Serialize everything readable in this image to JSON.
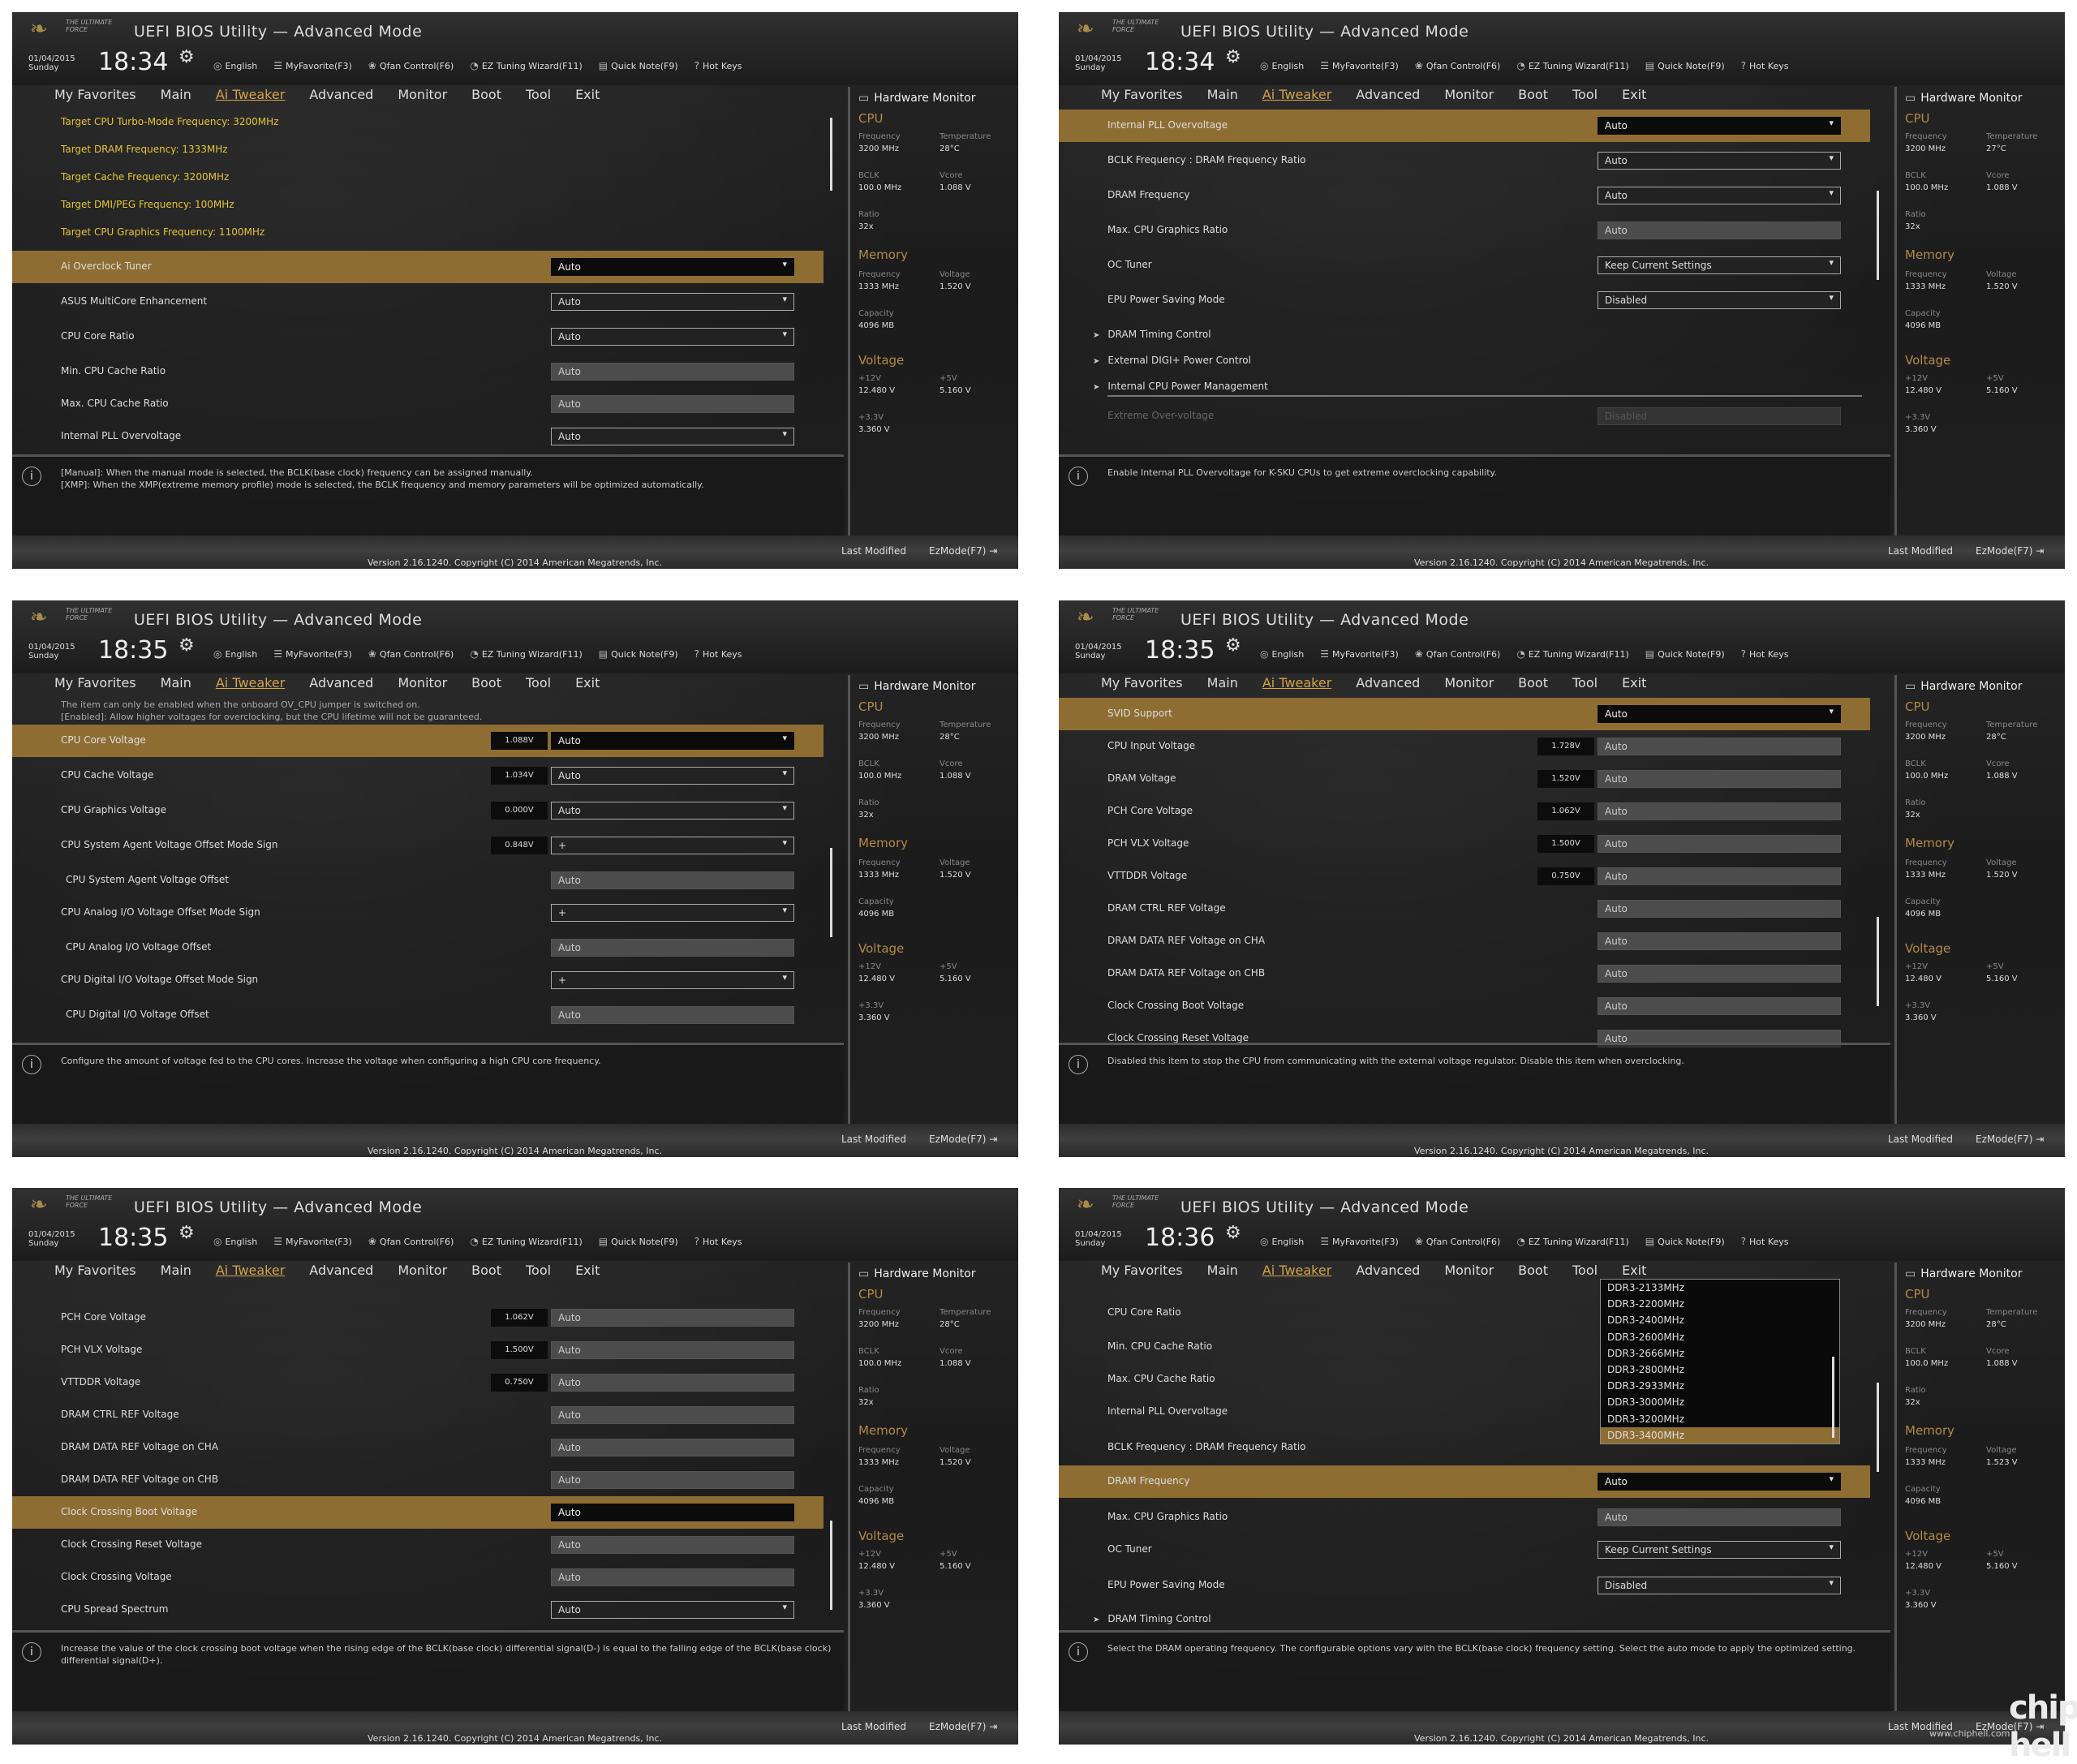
{
  "common": {
    "app_title": "UEFI BIOS Utility — Advanced Mode",
    "logo_text": "THE ULTIMATE FORCE",
    "date": "01/04/2015",
    "day": "Sunday",
    "menu": {
      "english": "English",
      "myfavorite": "MyFavorite(F3)",
      "qfan": "Qfan Control(F6)",
      "eztuning": "EZ Tuning Wizard(F11)",
      "quicknote": "Quick Note(F9)",
      "hotkeys": "Hot Keys"
    },
    "tabs": [
      "My Favorites",
      "Main",
      "Ai Tweaker",
      "Advanced",
      "Monitor",
      "Boot",
      "Tool",
      "Exit"
    ],
    "active_tab": "Ai Tweaker",
    "version": "Version 2.16.1240. Copyright (C) 2014 American Megatrends, Inc.",
    "last_modified": "Last Modified",
    "ezmode": "EzMode(F7)",
    "hw": {
      "title": "Hardware Monitor",
      "cpu": "CPU",
      "frequency_lbl": "Frequency",
      "temperature_lbl": "Temperature",
      "bclk_lbl": "BCLK",
      "vcore_lbl": "Vcore",
      "ratio_lbl": "Ratio",
      "memory": "Memory",
      "voltage_lbl": "Voltage",
      "capacity_lbl": "Capacity",
      "voltage": "Voltage",
      "v12_lbl": "+12V",
      "v5_lbl": "+5V",
      "v33_lbl": "+3.3V",
      "cpu_freq": "3200 MHz",
      "bclk": "100.0 MHz",
      "vcore": "1.088 V",
      "ratio": "32x",
      "mem_freq": "1333 MHz",
      "mem_cap": "4096 MB",
      "v12": "12.480 V",
      "v5": "5.160 V",
      "v33": "3.360 V"
    }
  },
  "panels": [
    {
      "time": "18:34",
      "temp": "28°C",
      "mem_volt": "1.520 V",
      "rows": [
        {
          "label": "Target CPU Turbo-Mode Frequency: 3200MHz",
          "kind": "target"
        },
        {
          "label": "Target DRAM Frequency: 1333MHz",
          "kind": "target"
        },
        {
          "label": "Target Cache Frequency: 3200MHz",
          "kind": "target"
        },
        {
          "label": "Target DMI/PEG Frequency: 100MHz",
          "kind": "target"
        },
        {
          "label": "Target CPU Graphics Frequency: 1100MHz",
          "kind": "target"
        },
        {
          "label": "Ai Overclock Tuner",
          "value": "Auto",
          "dropdown": true,
          "selected": true
        },
        {
          "label": "ASUS MultiCore Enhancement",
          "value": "Auto",
          "dropdown": true
        },
        {
          "label": "CPU Core Ratio",
          "value": "Auto",
          "dropdown": true
        },
        {
          "label": "Min. CPU Cache Ratio",
          "value": "Auto",
          "flat": true
        },
        {
          "label": "Max. CPU Cache Ratio",
          "value": "Auto",
          "flat": true
        },
        {
          "label": "Internal PLL Overvoltage",
          "value": "Auto",
          "dropdown": true
        }
      ],
      "help": [
        "[Manual]: When the manual mode is selected, the BCLK(base clock) frequency can be assigned manually.",
        "[XMP]: When the XMP(extreme memory profile) mode is selected, the BCLK frequency and memory parameters will be optimized automatically."
      ]
    },
    {
      "time": "18:34",
      "temp": "27°C",
      "mem_volt": "1.520 V",
      "rows": [
        {
          "label": "Internal PLL Overvoltage",
          "value": "Auto",
          "dropdown": true,
          "selected": true
        },
        {
          "label": "BCLK Frequency : DRAM Frequency Ratio",
          "value": "Auto",
          "dropdown": true
        },
        {
          "label": "DRAM Frequency",
          "value": "Auto",
          "dropdown": true
        },
        {
          "label": "Max. CPU Graphics Ratio",
          "value": "Auto",
          "flat": true
        },
        {
          "label": "OC Tuner",
          "value": "Keep Current Settings",
          "dropdown": true
        },
        {
          "label": "EPU Power Saving Mode",
          "value": "Disabled",
          "dropdown": true
        },
        {
          "label": "DRAM Timing Control",
          "kind": "sub"
        },
        {
          "label": "External DIGI+ Power Control",
          "kind": "sub"
        },
        {
          "label": "Internal CPU Power Management",
          "kind": "sub"
        },
        {
          "label": "Extreme Over-voltage",
          "value": "Disabled",
          "kind": "dim"
        }
      ],
      "help": [
        "Enable Internal PLL Overvoltage for K-SKU CPUs to get extreme overclocking capability."
      ]
    },
    {
      "time": "18:35",
      "temp": "28°C",
      "mem_volt": "1.520 V",
      "info": [
        "The item can only be enabled when the onboard OV_CPU jumper is switched on.",
        "[Enabled]: Allow higher voltages for overclocking, but the CPU lifetime will not be guaranteed."
      ],
      "rows": [
        {
          "label": "CPU Core Voltage",
          "volt": "1.088V",
          "value": "Auto",
          "dropdown": true,
          "selected": true
        },
        {
          "label": "CPU Cache Voltage",
          "volt": "1.034V",
          "value": "Auto",
          "dropdown": true
        },
        {
          "label": "CPU Graphics Voltage",
          "volt": "0.000V",
          "value": "Auto",
          "dropdown": true
        },
        {
          "label": "CPU System Agent Voltage Offset Mode Sign",
          "volt": "0.848V",
          "value": "+",
          "dropdown": true
        },
        {
          "label": "CPU System Agent Voltage Offset",
          "value": "Auto",
          "flat": true,
          "indent": true
        },
        {
          "label": "CPU Analog I/O Voltage Offset Mode Sign",
          "value": "+",
          "dropdown": true
        },
        {
          "label": "CPU Analog I/O Voltage Offset",
          "value": "Auto",
          "flat": true,
          "indent": true
        },
        {
          "label": "CPU Digital I/O Voltage Offset Mode Sign",
          "value": "+",
          "dropdown": true
        },
        {
          "label": "CPU Digital I/O Voltage Offset",
          "value": "Auto",
          "flat": true,
          "indent": true
        }
      ],
      "help": [
        "Configure the amount of voltage fed to the CPU cores. Increase the voltage when configuring a high CPU core frequency."
      ]
    },
    {
      "time": "18:35",
      "temp": "28°C",
      "mem_volt": "1.520 V",
      "rows": [
        {
          "label": "SVID Support",
          "value": "Auto",
          "dropdown": true,
          "selected": true
        },
        {
          "label": "CPU Input Voltage",
          "volt": "1.728V",
          "value": "Auto",
          "flat": true
        },
        {
          "label": "DRAM Voltage",
          "volt": "1.520V",
          "value": "Auto",
          "flat": true
        },
        {
          "label": "PCH Core Voltage",
          "volt": "1.062V",
          "value": "Auto",
          "flat": true
        },
        {
          "label": "PCH VLX Voltage",
          "volt": "1.500V",
          "value": "Auto",
          "flat": true
        },
        {
          "label": "VTTDDR Voltage",
          "volt": "0.750V",
          "value": "Auto",
          "flat": true
        },
        {
          "label": "DRAM CTRL REF Voltage",
          "value": "Auto",
          "flat": true
        },
        {
          "label": "DRAM DATA REF Voltage on CHA",
          "value": "Auto",
          "flat": true
        },
        {
          "label": "DRAM DATA REF Voltage on CHB",
          "value": "Auto",
          "flat": true
        },
        {
          "label": "Clock Crossing Boot Voltage",
          "value": "Auto",
          "flat": true
        },
        {
          "label": "Clock Crossing Reset Voltage",
          "value": "Auto",
          "flat": true
        }
      ],
      "help": [
        "Disabled this item to stop the CPU from communicating with the external voltage regulator. Disable this item when overclocking."
      ]
    },
    {
      "time": "18:35",
      "temp": "28°C",
      "mem_volt": "1.520 V",
      "rows": [
        {
          "label": "PCH Core Voltage",
          "volt": "1.062V",
          "value": "Auto",
          "flat": true
        },
        {
          "label": "PCH VLX Voltage",
          "volt": "1.500V",
          "value": "Auto",
          "flat": true
        },
        {
          "label": "VTTDDR Voltage",
          "volt": "0.750V",
          "value": "Auto",
          "flat": true
        },
        {
          "label": "DRAM CTRL REF Voltage",
          "value": "Auto",
          "flat": true
        },
        {
          "label": "DRAM DATA REF Voltage on CHA",
          "value": "Auto",
          "flat": true
        },
        {
          "label": "DRAM DATA REF Voltage on CHB",
          "value": "Auto",
          "flat": true
        },
        {
          "label": "Clock Crossing Boot Voltage",
          "value": "Auto",
          "selected": true
        },
        {
          "label": "Clock Crossing Reset Voltage",
          "value": "Auto",
          "flat": true
        },
        {
          "label": "Clock Crossing Voltage",
          "value": "Auto",
          "flat": true
        },
        {
          "label": "CPU Spread Spectrum",
          "value": "Auto",
          "dropdown": true
        }
      ],
      "help": [
        "Increase the value of the clock crossing boot voltage when the rising edge of the BCLK(base clock) differential signal(D-) is equal to the falling edge of the BCLK(base clock) differential signal(D+)."
      ]
    },
    {
      "time": "18:36",
      "temp": "28°C",
      "mem_volt": "1.523 V",
      "rows": [
        {
          "label": "CPU Core Ratio",
          "hidevalue": true
        },
        {
          "label": "Min. CPU Cache Ratio",
          "hidevalue": true
        },
        {
          "label": "Max. CPU Cache Ratio",
          "hidevalue": true
        },
        {
          "label": "Internal PLL Overvoltage",
          "hidevalue": true
        },
        {
          "label": "BCLK Frequency : DRAM Frequency Ratio",
          "hidevalue": true
        },
        {
          "label": "DRAM Frequency",
          "value": "Auto",
          "dropdown": true,
          "selected": true
        },
        {
          "label": "Max. CPU Graphics Ratio",
          "value": "Auto",
          "flat": true
        },
        {
          "label": "OC Tuner",
          "value": "Keep Current Settings",
          "dropdown": true
        },
        {
          "label": "EPU Power Saving Mode",
          "value": "Disabled",
          "dropdown": true
        },
        {
          "label": "DRAM Timing Control",
          "kind": "sub"
        }
      ],
      "help": [
        "Select the DRAM operating frequency. The configurable options vary with the BCLK(base clock) frequency setting. Select the auto mode to apply the optimized setting."
      ]
    }
  ],
  "dram_options": [
    "DDR3-2133MHz",
    "DDR3-2200MHz",
    "DDR3-2400MHz",
    "DDR3-2600MHz",
    "DDR3-2666MHz",
    "DDR3-2800MHz",
    "DDR3-2933MHz",
    "DDR3-3000MHz",
    "DDR3-3200MHz",
    "DDR3-3400MHz"
  ],
  "dram_highlight": "DDR3-3400MHz",
  "watermark": {
    "logo": "chip hell",
    "url": "www.chiphell.com"
  }
}
